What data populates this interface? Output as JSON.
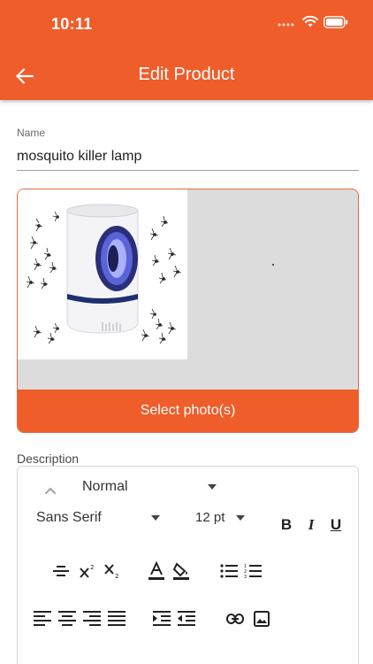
{
  "status": {
    "time": "10:11"
  },
  "appbar": {
    "title": "Edit Product"
  },
  "form": {
    "name_label": "Name",
    "name_value": "mosquito killer lamp"
  },
  "photos": {
    "select_label": "Select photo(s)"
  },
  "description": {
    "label": "Description",
    "toolbar": {
      "heading_select": "Normal",
      "font_select": "Sans Serif",
      "size_select": "12 pt",
      "bold": "B",
      "italic": "I",
      "underline": "U"
    }
  },
  "colors": {
    "accent": "#ef5d2b",
    "border_accent": "#e06a3e"
  }
}
